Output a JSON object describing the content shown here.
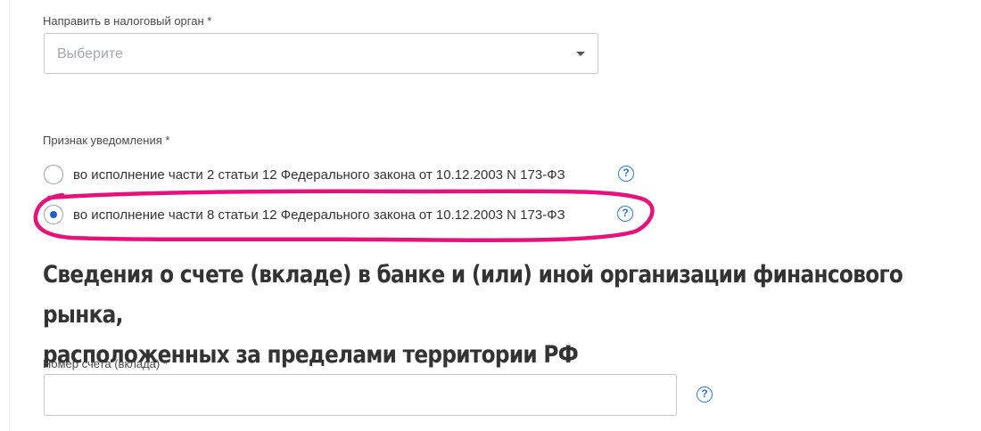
{
  "tax_authority": {
    "label": "Направить в налоговый орган *",
    "placeholder": "Выберите"
  },
  "notice_type": {
    "label": "Признак уведомления *",
    "options": [
      {
        "label": "во исполнение части 2 статьи 12 Федерального закона от 10.12.2003 N 173-ФЗ",
        "selected": false
      },
      {
        "label": "во исполнение части 8 статьи 12 Федерального закона от 10.12.2003 N 173-ФЗ",
        "selected": true
      }
    ],
    "help_glyph": "?"
  },
  "section": {
    "heading_line1": "Сведения о счете (вкладе) в банке и (или) иной организации финансового рынка,",
    "heading_line2": "расположенных за пределами территории РФ"
  },
  "account_number": {
    "label": "Номер счета (вклада) *",
    "value": "",
    "help_glyph": "?"
  },
  "colors": {
    "accent": "#1a5fd6",
    "help": "#2d7bd8",
    "annotation": "#e8107a"
  }
}
